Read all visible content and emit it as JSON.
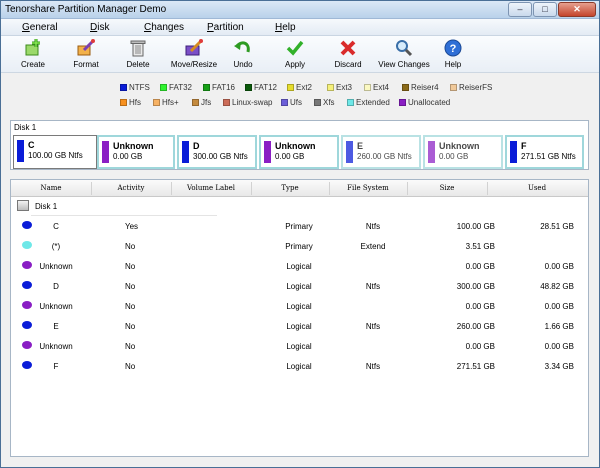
{
  "window": {
    "title": "Tenorshare Partition Manager Demo"
  },
  "menu": {
    "items": [
      "General",
      "Disk",
      "Changes",
      "Partition",
      "Help"
    ]
  },
  "toolbar": {
    "buttons": [
      {
        "label": "Create",
        "icon": "create-icon"
      },
      {
        "label": "Format",
        "icon": "format-icon"
      },
      {
        "label": "Delete",
        "icon": "delete-icon"
      },
      {
        "label": "Move/Resize",
        "icon": "move-resize-icon"
      },
      {
        "label": "Undo",
        "icon": "undo-icon"
      },
      {
        "label": "Apply",
        "icon": "apply-icon"
      },
      {
        "label": "Discard",
        "icon": "discard-icon"
      },
      {
        "label": "View Changes",
        "icon": "view-changes-icon"
      },
      {
        "label": "Help",
        "icon": "help-icon"
      }
    ]
  },
  "legend": {
    "items": [
      {
        "label": "NTFS",
        "color": "#0a1cd8"
      },
      {
        "label": "FAT32",
        "color": "#2ff42f"
      },
      {
        "label": "FAT16",
        "color": "#17a017"
      },
      {
        "label": "FAT12",
        "color": "#0b5a0b"
      },
      {
        "label": "Ext2",
        "color": "#e6dd2d"
      },
      {
        "label": "Ext3",
        "color": "#f5f07a"
      },
      {
        "label": "Ext4",
        "color": "#fbf9c2"
      },
      {
        "label": "Reiser4",
        "color": "#8b6a18"
      },
      {
        "label": "ReiserFS",
        "color": "#f0c99a"
      },
      {
        "label": "Hfs",
        "color": "#f7901e"
      },
      {
        "label": "Hfs+",
        "color": "#f7b264"
      },
      {
        "label": "Jfs",
        "color": "#c48a3e"
      },
      {
        "label": "Linux-swap",
        "color": "#cc6c58"
      },
      {
        "label": "Ufs",
        "color": "#6b5ed8"
      },
      {
        "label": "Xfs",
        "color": "#777777"
      },
      {
        "label": "Extended",
        "color": "#6ee8e8"
      },
      {
        "label": "Unallocated",
        "color": "#8a1ec4"
      }
    ]
  },
  "disk_map": {
    "label": "Disk 1",
    "partitions": [
      {
        "name": "C",
        "size": "100.00 GB Ntfs",
        "color": "#0a1cd8"
      },
      {
        "name": "Unknown",
        "size": "0.00 GB",
        "color": "#8a1ec4"
      },
      {
        "name": "D",
        "size": "300.00 GB Ntfs",
        "color": "#0a1cd8"
      },
      {
        "name": "Unknown",
        "size": "0.00 GB",
        "color": "#8a1ec4"
      },
      {
        "name": "E",
        "size": "260.00 GB Ntfs",
        "color": "#0a1cd8"
      },
      {
        "name": "Unknown",
        "size": "0.00 GB",
        "color": "#8a1ec4"
      },
      {
        "name": "F",
        "size": "271.51 GB Ntfs",
        "color": "#0a1cd8"
      }
    ]
  },
  "table": {
    "columns": [
      "Name",
      "Activity",
      "Volume Label",
      "Type",
      "File System",
      "Size",
      "Used"
    ],
    "disk_label": "Disk 1",
    "rows": [
      {
        "name": "C",
        "activity": "Yes",
        "type": "Primary",
        "fs": "Ntfs",
        "size": "100.00 GB",
        "used": "28.51 GB",
        "icon": "ntfs-partition-icon",
        "color": "#0a1cd8"
      },
      {
        "name": "(*)",
        "activity": "No",
        "type": "Primary",
        "fs": "Extend",
        "size": "3.51 GB",
        "used": "",
        "icon": "extended-partition-icon",
        "color": "#6ee8e8"
      },
      {
        "name": "Unknown",
        "activity": "No",
        "type": "Logical",
        "fs": "",
        "size": "0.00 GB",
        "used": "0.00 GB",
        "icon": "unallocated-partition-icon",
        "color": "#8a1ec4"
      },
      {
        "name": "D",
        "activity": "No",
        "type": "Logical",
        "fs": "Ntfs",
        "size": "300.00 GB",
        "used": "48.82 GB",
        "icon": "ntfs-partition-icon",
        "color": "#0a1cd8"
      },
      {
        "name": "Unknown",
        "activity": "No",
        "type": "Logical",
        "fs": "",
        "size": "0.00 GB",
        "used": "0.00 GB",
        "icon": "unallocated-partition-icon",
        "color": "#8a1ec4"
      },
      {
        "name": "E",
        "activity": "No",
        "type": "Logical",
        "fs": "Ntfs",
        "size": "260.00 GB",
        "used": "1.66 GB",
        "icon": "ntfs-partition-icon",
        "color": "#0a1cd8"
      },
      {
        "name": "Unknown",
        "activity": "No",
        "type": "Logical",
        "fs": "",
        "size": "0.00 GB",
        "used": "0.00 GB",
        "icon": "unallocated-partition-icon",
        "color": "#8a1ec4"
      },
      {
        "name": "F",
        "activity": "No",
        "type": "Logical",
        "fs": "Ntfs",
        "size": "271.51 GB",
        "used": "3.34 GB",
        "icon": "ntfs-partition-icon",
        "color": "#0a1cd8"
      }
    ]
  }
}
